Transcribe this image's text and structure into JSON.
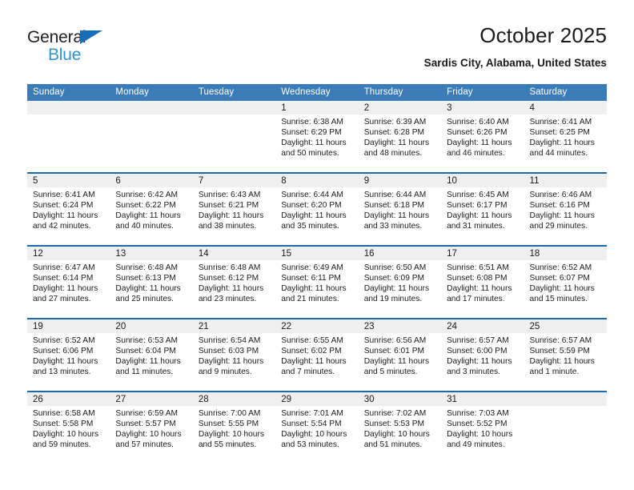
{
  "brand": {
    "name_part1": "General",
    "name_part2": "Blue",
    "accent_color": "#1570b8",
    "accent_color_light": "#2e93d9"
  },
  "header": {
    "title": "October 2025",
    "location": "Sardis City, Alabama, United States"
  },
  "theme": {
    "header_bg": "#3b7cb8",
    "row_divider": "#1a69ae",
    "daynum_band_bg": "#efefef",
    "text": "#1a1a1a"
  },
  "weekday_headers": [
    "Sunday",
    "Monday",
    "Tuesday",
    "Wednesday",
    "Thursday",
    "Friday",
    "Saturday"
  ],
  "weeks": [
    [
      {
        "day": "",
        "empty": true,
        "sunrise": "",
        "sunset": "",
        "daylight_line1": "",
        "daylight_line2": ""
      },
      {
        "day": "",
        "empty": true,
        "sunrise": "",
        "sunset": "",
        "daylight_line1": "",
        "daylight_line2": ""
      },
      {
        "day": "",
        "empty": true,
        "sunrise": "",
        "sunset": "",
        "daylight_line1": "",
        "daylight_line2": ""
      },
      {
        "day": "1",
        "empty": false,
        "sunrise": "Sunrise: 6:38 AM",
        "sunset": "Sunset: 6:29 PM",
        "daylight_line1": "Daylight: 11 hours",
        "daylight_line2": "and 50 minutes."
      },
      {
        "day": "2",
        "empty": false,
        "sunrise": "Sunrise: 6:39 AM",
        "sunset": "Sunset: 6:28 PM",
        "daylight_line1": "Daylight: 11 hours",
        "daylight_line2": "and 48 minutes."
      },
      {
        "day": "3",
        "empty": false,
        "sunrise": "Sunrise: 6:40 AM",
        "sunset": "Sunset: 6:26 PM",
        "daylight_line1": "Daylight: 11 hours",
        "daylight_line2": "and 46 minutes."
      },
      {
        "day": "4",
        "empty": false,
        "sunrise": "Sunrise: 6:41 AM",
        "sunset": "Sunset: 6:25 PM",
        "daylight_line1": "Daylight: 11 hours",
        "daylight_line2": "and 44 minutes."
      }
    ],
    [
      {
        "day": "5",
        "empty": false,
        "sunrise": "Sunrise: 6:41 AM",
        "sunset": "Sunset: 6:24 PM",
        "daylight_line1": "Daylight: 11 hours",
        "daylight_line2": "and 42 minutes."
      },
      {
        "day": "6",
        "empty": false,
        "sunrise": "Sunrise: 6:42 AM",
        "sunset": "Sunset: 6:22 PM",
        "daylight_line1": "Daylight: 11 hours",
        "daylight_line2": "and 40 minutes."
      },
      {
        "day": "7",
        "empty": false,
        "sunrise": "Sunrise: 6:43 AM",
        "sunset": "Sunset: 6:21 PM",
        "daylight_line1": "Daylight: 11 hours",
        "daylight_line2": "and 38 minutes."
      },
      {
        "day": "8",
        "empty": false,
        "sunrise": "Sunrise: 6:44 AM",
        "sunset": "Sunset: 6:20 PM",
        "daylight_line1": "Daylight: 11 hours",
        "daylight_line2": "and 35 minutes."
      },
      {
        "day": "9",
        "empty": false,
        "sunrise": "Sunrise: 6:44 AM",
        "sunset": "Sunset: 6:18 PM",
        "daylight_line1": "Daylight: 11 hours",
        "daylight_line2": "and 33 minutes."
      },
      {
        "day": "10",
        "empty": false,
        "sunrise": "Sunrise: 6:45 AM",
        "sunset": "Sunset: 6:17 PM",
        "daylight_line1": "Daylight: 11 hours",
        "daylight_line2": "and 31 minutes."
      },
      {
        "day": "11",
        "empty": false,
        "sunrise": "Sunrise: 6:46 AM",
        "sunset": "Sunset: 6:16 PM",
        "daylight_line1": "Daylight: 11 hours",
        "daylight_line2": "and 29 minutes."
      }
    ],
    [
      {
        "day": "12",
        "empty": false,
        "sunrise": "Sunrise: 6:47 AM",
        "sunset": "Sunset: 6:14 PM",
        "daylight_line1": "Daylight: 11 hours",
        "daylight_line2": "and 27 minutes."
      },
      {
        "day": "13",
        "empty": false,
        "sunrise": "Sunrise: 6:48 AM",
        "sunset": "Sunset: 6:13 PM",
        "daylight_line1": "Daylight: 11 hours",
        "daylight_line2": "and 25 minutes."
      },
      {
        "day": "14",
        "empty": false,
        "sunrise": "Sunrise: 6:48 AM",
        "sunset": "Sunset: 6:12 PM",
        "daylight_line1": "Daylight: 11 hours",
        "daylight_line2": "and 23 minutes."
      },
      {
        "day": "15",
        "empty": false,
        "sunrise": "Sunrise: 6:49 AM",
        "sunset": "Sunset: 6:11 PM",
        "daylight_line1": "Daylight: 11 hours",
        "daylight_line2": "and 21 minutes."
      },
      {
        "day": "16",
        "empty": false,
        "sunrise": "Sunrise: 6:50 AM",
        "sunset": "Sunset: 6:09 PM",
        "daylight_line1": "Daylight: 11 hours",
        "daylight_line2": "and 19 minutes."
      },
      {
        "day": "17",
        "empty": false,
        "sunrise": "Sunrise: 6:51 AM",
        "sunset": "Sunset: 6:08 PM",
        "daylight_line1": "Daylight: 11 hours",
        "daylight_line2": "and 17 minutes."
      },
      {
        "day": "18",
        "empty": false,
        "sunrise": "Sunrise: 6:52 AM",
        "sunset": "Sunset: 6:07 PM",
        "daylight_line1": "Daylight: 11 hours",
        "daylight_line2": "and 15 minutes."
      }
    ],
    [
      {
        "day": "19",
        "empty": false,
        "sunrise": "Sunrise: 6:52 AM",
        "sunset": "Sunset: 6:06 PM",
        "daylight_line1": "Daylight: 11 hours",
        "daylight_line2": "and 13 minutes."
      },
      {
        "day": "20",
        "empty": false,
        "sunrise": "Sunrise: 6:53 AM",
        "sunset": "Sunset: 6:04 PM",
        "daylight_line1": "Daylight: 11 hours",
        "daylight_line2": "and 11 minutes."
      },
      {
        "day": "21",
        "empty": false,
        "sunrise": "Sunrise: 6:54 AM",
        "sunset": "Sunset: 6:03 PM",
        "daylight_line1": "Daylight: 11 hours",
        "daylight_line2": "and 9 minutes."
      },
      {
        "day": "22",
        "empty": false,
        "sunrise": "Sunrise: 6:55 AM",
        "sunset": "Sunset: 6:02 PM",
        "daylight_line1": "Daylight: 11 hours",
        "daylight_line2": "and 7 minutes."
      },
      {
        "day": "23",
        "empty": false,
        "sunrise": "Sunrise: 6:56 AM",
        "sunset": "Sunset: 6:01 PM",
        "daylight_line1": "Daylight: 11 hours",
        "daylight_line2": "and 5 minutes."
      },
      {
        "day": "24",
        "empty": false,
        "sunrise": "Sunrise: 6:57 AM",
        "sunset": "Sunset: 6:00 PM",
        "daylight_line1": "Daylight: 11 hours",
        "daylight_line2": "and 3 minutes."
      },
      {
        "day": "25",
        "empty": false,
        "sunrise": "Sunrise: 6:57 AM",
        "sunset": "Sunset: 5:59 PM",
        "daylight_line1": "Daylight: 11 hours",
        "daylight_line2": "and 1 minute."
      }
    ],
    [
      {
        "day": "26",
        "empty": false,
        "sunrise": "Sunrise: 6:58 AM",
        "sunset": "Sunset: 5:58 PM",
        "daylight_line1": "Daylight: 10 hours",
        "daylight_line2": "and 59 minutes."
      },
      {
        "day": "27",
        "empty": false,
        "sunrise": "Sunrise: 6:59 AM",
        "sunset": "Sunset: 5:57 PM",
        "daylight_line1": "Daylight: 10 hours",
        "daylight_line2": "and 57 minutes."
      },
      {
        "day": "28",
        "empty": false,
        "sunrise": "Sunrise: 7:00 AM",
        "sunset": "Sunset: 5:55 PM",
        "daylight_line1": "Daylight: 10 hours",
        "daylight_line2": "and 55 minutes."
      },
      {
        "day": "29",
        "empty": false,
        "sunrise": "Sunrise: 7:01 AM",
        "sunset": "Sunset: 5:54 PM",
        "daylight_line1": "Daylight: 10 hours",
        "daylight_line2": "and 53 minutes."
      },
      {
        "day": "30",
        "empty": false,
        "sunrise": "Sunrise: 7:02 AM",
        "sunset": "Sunset: 5:53 PM",
        "daylight_line1": "Daylight: 10 hours",
        "daylight_line2": "and 51 minutes."
      },
      {
        "day": "31",
        "empty": false,
        "sunrise": "Sunrise: 7:03 AM",
        "sunset": "Sunset: 5:52 PM",
        "daylight_line1": "Daylight: 10 hours",
        "daylight_line2": "and 49 minutes."
      },
      {
        "day": "",
        "empty": true,
        "sunrise": "",
        "sunset": "",
        "daylight_line1": "",
        "daylight_line2": ""
      }
    ]
  ]
}
